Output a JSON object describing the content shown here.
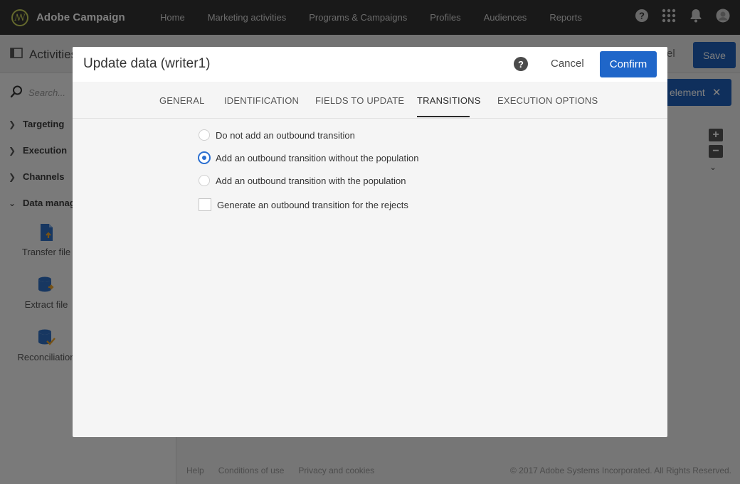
{
  "app": {
    "brand": "Adobe Campaign",
    "nav": [
      "Home",
      "Marketing activities",
      "Programs & Campaigns",
      "Profiles",
      "Audiences",
      "Reports"
    ]
  },
  "background": {
    "activities_title": "Activities",
    "cancel_fragment": "el",
    "save_label": "Save",
    "search_placeholder": "Search...",
    "categories": [
      "Targeting",
      "Execution",
      "Channels",
      "Data manage"
    ],
    "tools": [
      "Transfer file",
      "Extract file",
      "Reconciliation"
    ],
    "element_button": "element",
    "footer": {
      "links": [
        "Help",
        "Conditions of use",
        "Privacy and cookies"
      ],
      "copyright": "© 2017 Adobe Systems Incorporated. All Rights Reserved."
    }
  },
  "dialog": {
    "title": "Update data (writer1)",
    "help_label": "?",
    "cancel_label": "Cancel",
    "confirm_label": "Confirm",
    "tabs": [
      "GENERAL",
      "IDENTIFICATION",
      "FIELDS TO UPDATE",
      "TRANSITIONS",
      "EXECUTION OPTIONS"
    ],
    "active_tab": "TRANSITIONS",
    "options": [
      {
        "label": "Do not add an outbound transition",
        "checked": false
      },
      {
        "label": "Add an outbound transition without the population",
        "checked": true
      },
      {
        "label": "Add an outbound transition with the population",
        "checked": false
      }
    ],
    "checkbox": {
      "label": "Generate an outbound transition for the rejects",
      "checked": false
    }
  },
  "colors": {
    "accent": "#1f66c9",
    "topbar": "#323232"
  }
}
